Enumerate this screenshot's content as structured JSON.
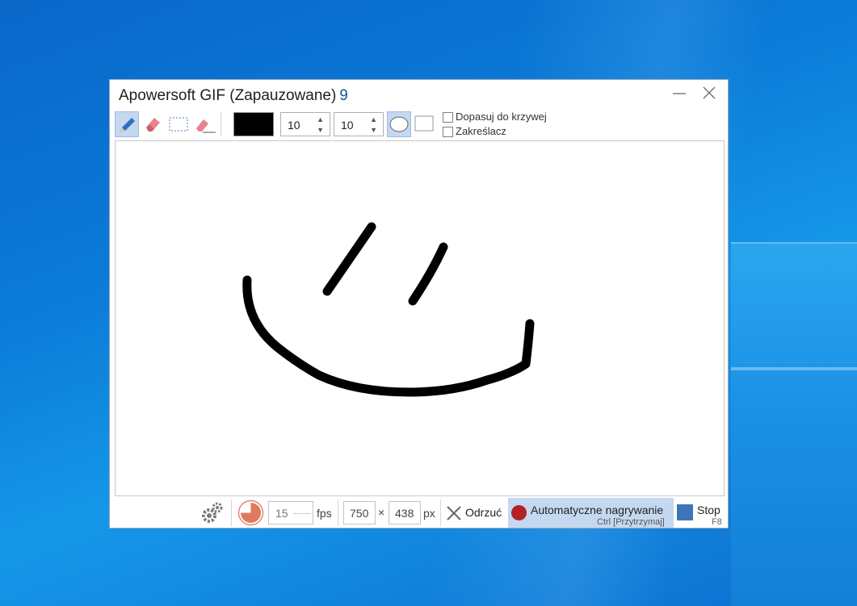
{
  "window": {
    "title": "Apowersoft GIF (Zapauzowane)",
    "frame_count": "9"
  },
  "toolbar": {
    "tools": [
      {
        "name": "pencil",
        "active": true
      },
      {
        "name": "eraser",
        "active": false
      },
      {
        "name": "select-rectangle",
        "active": false
      },
      {
        "name": "erase-line",
        "active": false
      }
    ],
    "color": "#000000",
    "width_value": "10",
    "height_value": "10",
    "shape_ellipse_active": true,
    "fit_to_curve_label": "Dopasuj do krzywej",
    "highlighter_label": "Zakreślacz"
  },
  "status": {
    "fps_value": "15",
    "fps_label": "fps",
    "width": "750",
    "times": "×",
    "height": "438",
    "px_label": "px",
    "discard_label": "Odrzuć",
    "auto_record_label": "Automatyczne nagrywanie",
    "auto_record_shortcut": "Ctrl [Przytrzymaj]",
    "stop_label": "Stop",
    "stop_shortcut": "F8"
  }
}
